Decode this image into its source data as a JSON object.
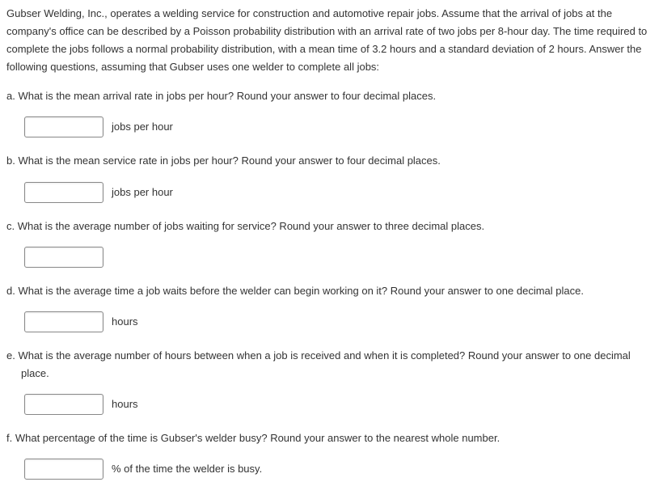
{
  "intro": "Gubser Welding, Inc., operates a welding service for construction and automotive repair jobs. Assume that the arrival of jobs at the company's office can be described by a Poisson probability distribution with an arrival rate of two jobs per 8-hour day. The time required to complete the jobs follows a normal probability distribution, with a mean time of 3.2 hours and a standard deviation of 2 hours. Answer the following questions, assuming that Gubser uses one welder to complete all jobs:",
  "questions": {
    "a": {
      "text": "a. What is the mean arrival rate in jobs per hour? Round your answer to four decimal places.",
      "unit": "jobs per hour",
      "value": ""
    },
    "b": {
      "text": "b. What is the mean service rate in jobs per hour? Round your answer to four decimal places.",
      "unit": "jobs per hour",
      "value": ""
    },
    "c": {
      "text": "c. What is the average number of jobs waiting for service? Round your answer to three decimal places.",
      "unit": "",
      "value": ""
    },
    "d": {
      "text": "d. What is the average time a job waits before the welder can begin working on it? Round your answer to one decimal place.",
      "unit": "hours",
      "value": ""
    },
    "e": {
      "text_line1": "e. What is the average number of hours between when a job is received and when it is completed? Round your answer to one decimal",
      "text_line2": "place.",
      "unit": "hours",
      "value": ""
    },
    "f": {
      "text": "f. What percentage of the time is Gubser's welder busy? Round your answer to the nearest whole number.",
      "unit": "% of the time the welder is busy.",
      "value": ""
    }
  }
}
